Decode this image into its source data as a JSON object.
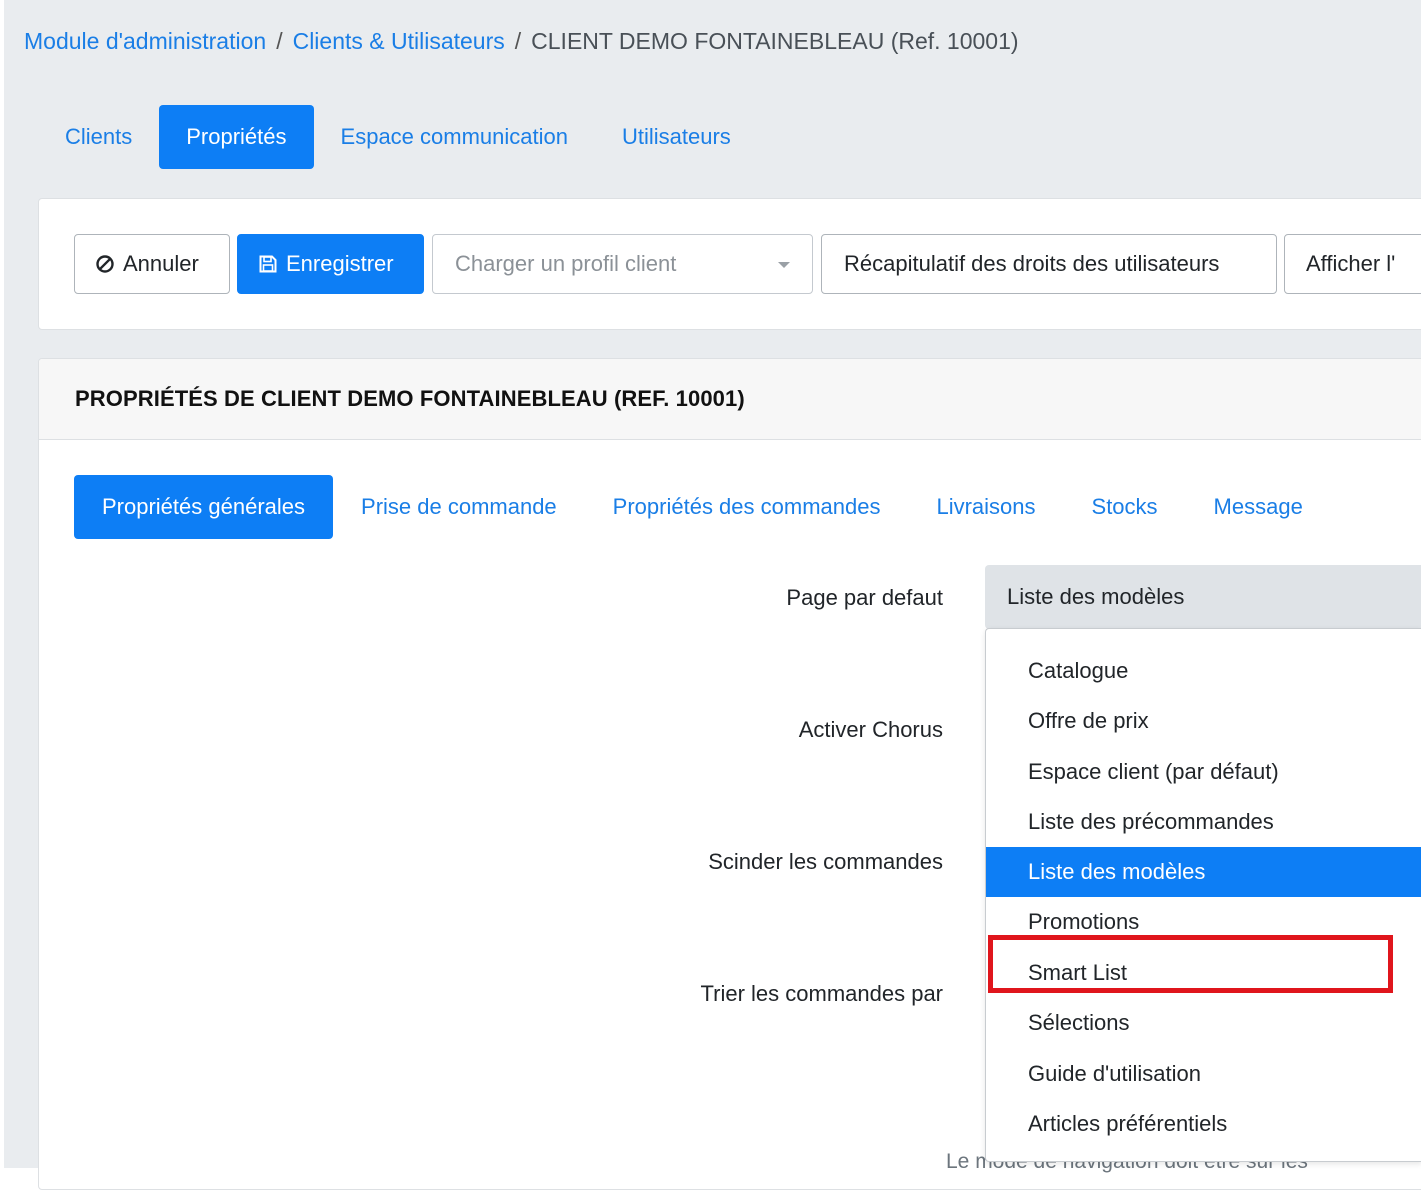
{
  "breadcrumb": {
    "items": [
      "Module d'administration",
      "Clients & Utilisateurs"
    ],
    "separator": "/",
    "current": "CLIENT DEMO FONTAINEBLEAU (Ref. 10001)"
  },
  "top_tabs": [
    {
      "label": "Clients",
      "active": false
    },
    {
      "label": "Propriétés",
      "active": true
    },
    {
      "label": "Espace communication",
      "active": false
    },
    {
      "label": "Utilisateurs",
      "active": false
    }
  ],
  "toolbar": {
    "cancel_label": "Annuler",
    "save_label": "Enregistrer",
    "profile_placeholder": "Charger un profil client",
    "rights_summary_label": "Récapitulatif des droits des utilisateurs",
    "show_label": "Afficher l'"
  },
  "properties": {
    "title": "PROPRIÉTÉS DE CLIENT DEMO FONTAINEBLEAU (REF. 10001)",
    "sub_tabs": [
      {
        "label": "Propriétés générales",
        "active": true
      },
      {
        "label": "Prise de commande",
        "active": false
      },
      {
        "label": "Propriétés des commandes",
        "active": false
      },
      {
        "label": "Livraisons",
        "active": false
      },
      {
        "label": "Stocks",
        "active": false
      },
      {
        "label": "Message",
        "active": false
      }
    ],
    "labels": {
      "default_page": "Page par defaut",
      "chorus": "Activer Chorus",
      "split_orders": "Scinder les commandes",
      "sort_orders": "Trier les commandes par"
    },
    "default_page_value": "Liste des modèles",
    "hint_partial": "Le mode de navigation doit être sur les"
  },
  "dropdown": {
    "options": [
      "Catalogue",
      "Offre de prix",
      "Espace client (par défaut)",
      "Liste des précommandes",
      "Liste des modèles",
      "Promotions",
      "Smart List",
      "Sélections",
      "Guide d'utilisation",
      "Articles préférentiels"
    ],
    "selected": "Liste des modèles",
    "highlighted": "Smart List"
  },
  "colors": {
    "primary": "#0d7ef5",
    "link": "#1a7ee6",
    "background": "#e9ecef",
    "highlight": "#e0151c"
  }
}
